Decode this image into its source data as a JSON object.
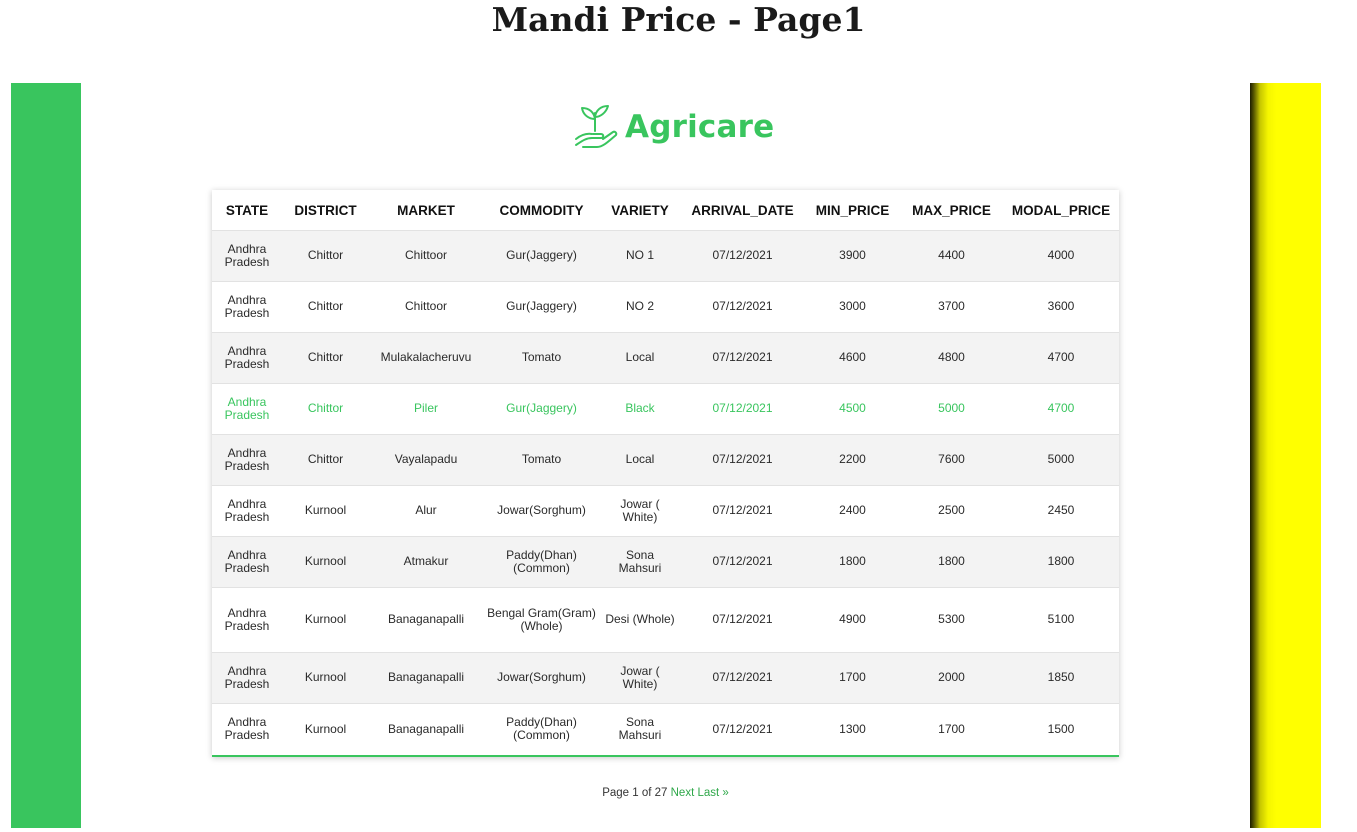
{
  "page": {
    "title": "Mandi Price - Page1"
  },
  "brand": {
    "name": "Agricare",
    "icon": "plant-hand-icon",
    "color": "#39c55e"
  },
  "colors": {
    "left_bar": "#39c55e",
    "right_bar": "#ffff00",
    "highlight_text": "#39c55e"
  },
  "table": {
    "columns": [
      "STATE",
      "DISTRICT",
      "MARKET",
      "COMMODITY",
      "VARIETY",
      "ARRIVAL_DATE",
      "MIN_PRICE",
      "MAX_PRICE",
      "MODAL_PRICE"
    ],
    "rows": [
      [
        "Andhra Pradesh",
        "Chittor",
        "Chittoor",
        "Gur(Jaggery)",
        "NO 1",
        "07/12/2021",
        "3900",
        "4400",
        "4000"
      ],
      [
        "Andhra Pradesh",
        "Chittor",
        "Chittoor",
        "Gur(Jaggery)",
        "NO 2",
        "07/12/2021",
        "3000",
        "3700",
        "3600"
      ],
      [
        "Andhra Pradesh",
        "Chittor",
        "Mulakalacheruvu",
        "Tomato",
        "Local",
        "07/12/2021",
        "4600",
        "4800",
        "4700"
      ],
      [
        "Andhra Pradesh",
        "Chittor",
        "Piler",
        "Gur(Jaggery)",
        "Black",
        "07/12/2021",
        "4500",
        "5000",
        "4700"
      ],
      [
        "Andhra Pradesh",
        "Chittor",
        "Vayalapadu",
        "Tomato",
        "Local",
        "07/12/2021",
        "2200",
        "7600",
        "5000"
      ],
      [
        "Andhra Pradesh",
        "Kurnool",
        "Alur",
        "Jowar(Sorghum)",
        "Jowar ( White)",
        "07/12/2021",
        "2400",
        "2500",
        "2450"
      ],
      [
        "Andhra Pradesh",
        "Kurnool",
        "Atmakur",
        "Paddy(Dhan)(Common)",
        "Sona Mahsuri",
        "07/12/2021",
        "1800",
        "1800",
        "1800"
      ],
      [
        "Andhra Pradesh",
        "Kurnool",
        "Banaganapalli",
        "Bengal Gram(Gram)(Whole)",
        "Desi (Whole)",
        "07/12/2021",
        "4900",
        "5300",
        "5100"
      ],
      [
        "Andhra Pradesh",
        "Kurnool",
        "Banaganapalli",
        "Jowar(Sorghum)",
        "Jowar ( White)",
        "07/12/2021",
        "1700",
        "2000",
        "1850"
      ],
      [
        "Andhra Pradesh",
        "Kurnool",
        "Banaganapalli",
        "Paddy(Dhan)(Common)",
        "Sona Mahsuri",
        "07/12/2021",
        "1300",
        "1700",
        "1500"
      ]
    ],
    "highlighted_row_index": 3
  },
  "pagination": {
    "status": "Page 1 of 27",
    "next_label": "Next",
    "last_label": "Last »"
  }
}
